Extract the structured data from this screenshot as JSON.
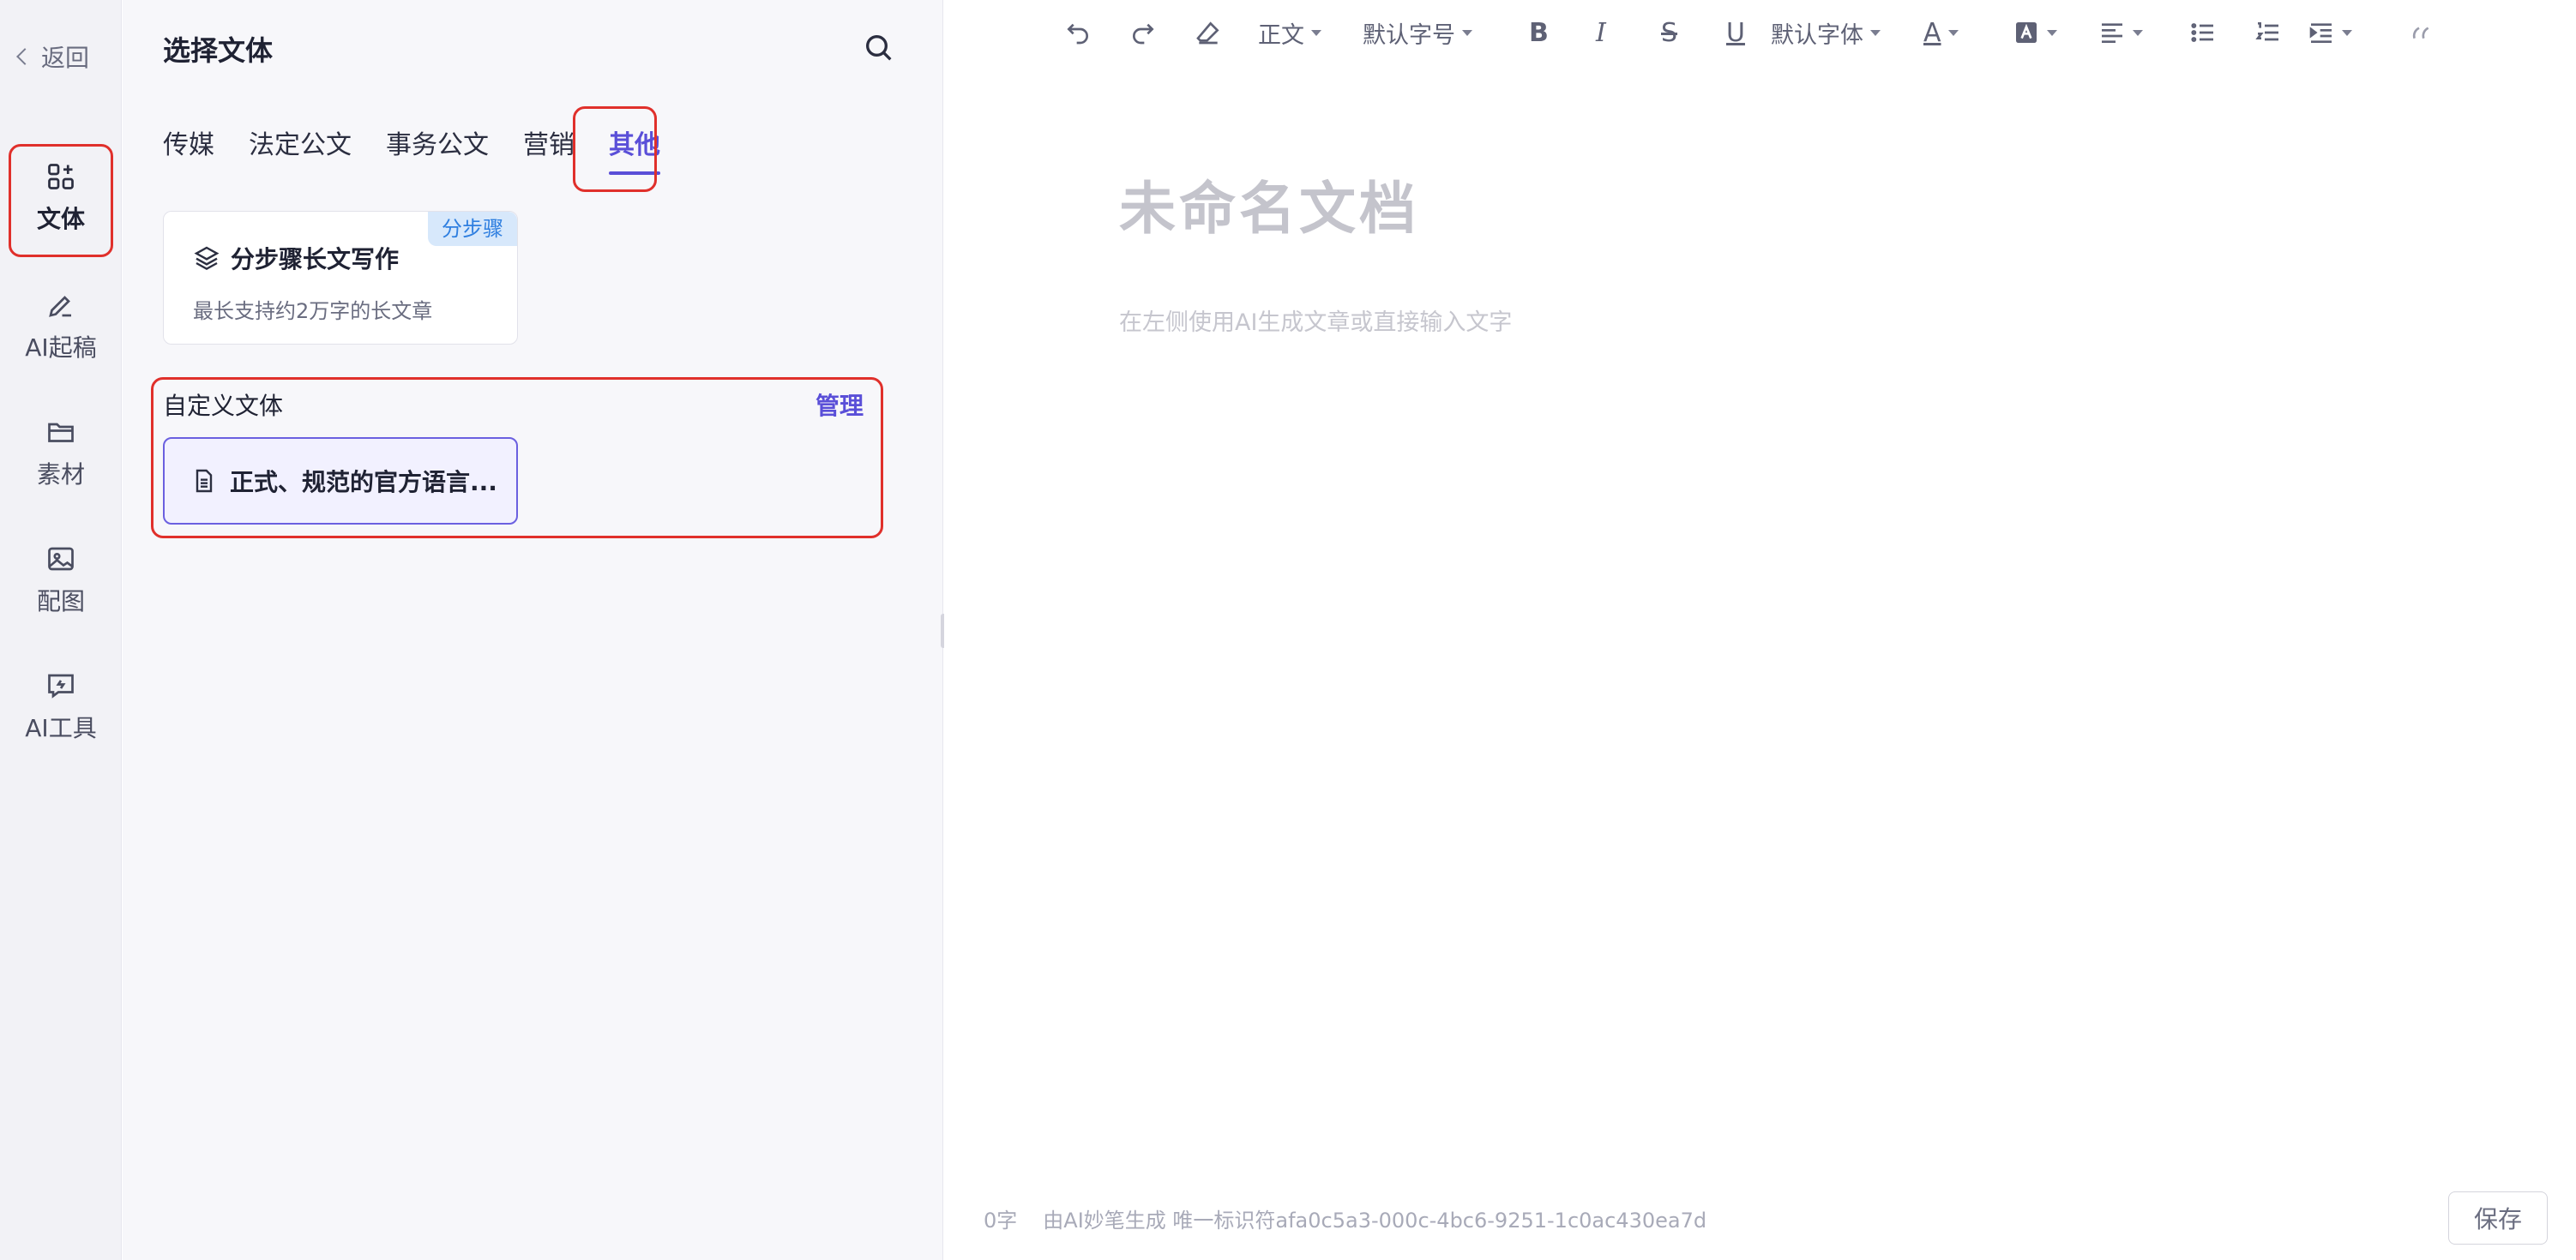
{
  "rail": {
    "back_label": "返回",
    "items": [
      {
        "label": "文体",
        "icon": "grid-icon",
        "active": true
      },
      {
        "label": "AI起稿",
        "icon": "pen-icon"
      },
      {
        "label": "素材",
        "icon": "folder-icon"
      },
      {
        "label": "配图",
        "icon": "image-icon"
      },
      {
        "label": "AI工具",
        "icon": "chat-tool-icon"
      }
    ]
  },
  "panel": {
    "title": "选择文体",
    "tabs": [
      {
        "label": "传媒"
      },
      {
        "label": "法定公文"
      },
      {
        "label": "事务公文"
      },
      {
        "label": "营销"
      },
      {
        "label": "其他",
        "active": true
      }
    ],
    "card": {
      "title": "分步骤长文写作",
      "description": "最长支持约2万字的长文章",
      "badge": "分步骤"
    },
    "custom": {
      "title": "自定义文体",
      "manage_label": "管理",
      "item_label": "正式、规范的官方语言..."
    }
  },
  "editor": {
    "toolbar": {
      "paragraph_style": "正文",
      "font_size": "默认字号",
      "font_family": "默认字体"
    },
    "doc_title": "未命名文档",
    "doc_placeholder": "在左侧使用AI生成文章或直接输入文字",
    "status": {
      "word_count": "0字",
      "generated_by": "由AI妙笔生成 唯一标识符afa0c5a3-000c-4bc6-9251-1c0ac430ea7d"
    },
    "save_label": "保存"
  },
  "colors": {
    "accent": "#5a4fd8",
    "highlight": "#e0302b",
    "badge_bg": "#d7e8fb",
    "badge_text": "#2f7fe0"
  }
}
